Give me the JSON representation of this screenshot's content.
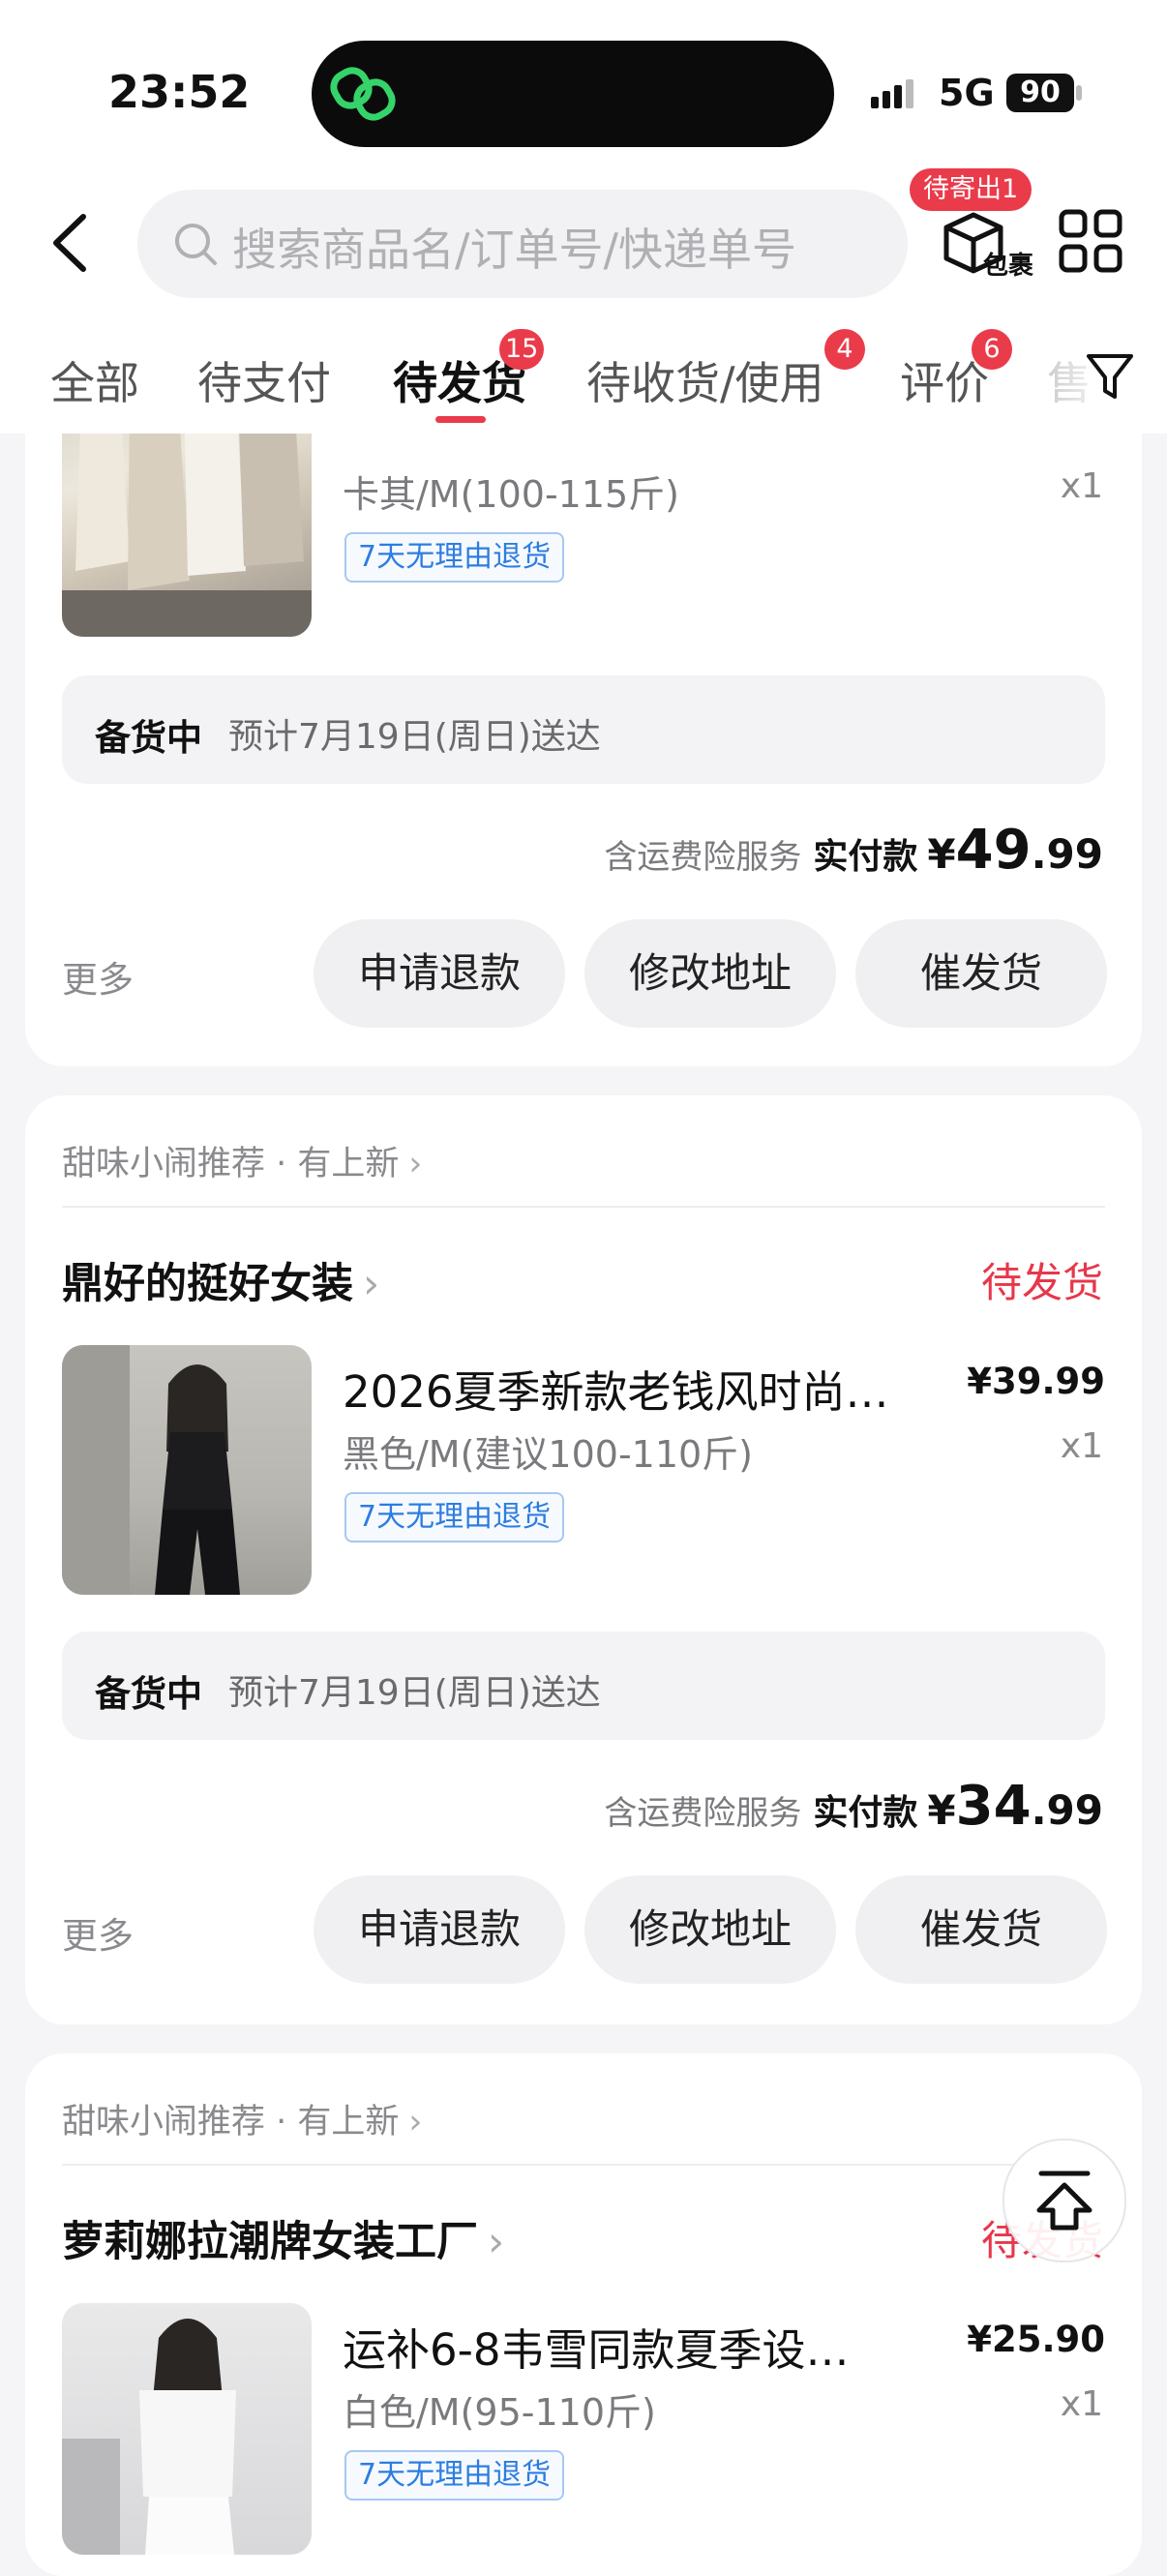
{
  "status_bar": {
    "time": "23:52",
    "network": "5G",
    "battery": "90"
  },
  "header": {
    "search_placeholder": "搜索商品名/订单号/快递单号",
    "package_label": "包裹",
    "package_badge": "待寄出1"
  },
  "tabs": [
    {
      "label": "全部",
      "badge": ""
    },
    {
      "label": "待支付",
      "badge": ""
    },
    {
      "label": "待发货",
      "badge": "15"
    },
    {
      "label": "待收货/使用",
      "badge": "4"
    },
    {
      "label": "评价",
      "badge": "6"
    },
    {
      "label": "售",
      "badge": ""
    }
  ],
  "orders": [
    {
      "spec": "卡其/M(100-115斤)",
      "qty": "x1",
      "tag": "7天无理由退货",
      "status_label": "备货中",
      "status_text": "预计7月19日(周日)送达",
      "insurance": "含运费险服务",
      "paid_label": "实付款",
      "paid_currency": "¥",
      "paid_int": "49",
      "paid_dec": ".99",
      "more": "更多",
      "buttons": [
        "申请退款",
        "修改地址",
        "催发货"
      ]
    },
    {
      "recommend": "甜味小闹推荐 · 有上新",
      "shop": "鼎好的挺好女装",
      "shop_state": "待发货",
      "title": "2026夏季新款老钱风时尚…",
      "price": "¥39.99",
      "spec": "黑色/M(建议100-110斤)",
      "qty": "x1",
      "tag": "7天无理由退货",
      "status_label": "备货中",
      "status_text": "预计7月19日(周日)送达",
      "insurance": "含运费险服务",
      "paid_label": "实付款",
      "paid_currency": "¥",
      "paid_int": "34",
      "paid_dec": ".99",
      "more": "更多",
      "buttons": [
        "申请退款",
        "修改地址",
        "催发货"
      ]
    },
    {
      "recommend": "甜味小闹推荐 · 有上新",
      "shop": "萝莉娜拉潮牌女装工厂",
      "shop_state": "待发货",
      "title": "运补6-8韦雪同款夏季设…",
      "price": "¥25.90",
      "spec": "白色/M(95-110斤)",
      "qty": "x1",
      "tag": "7天无理由退货"
    }
  ],
  "colors": {
    "accent": "#ea3b4b",
    "tag_blue": "#2d7de0"
  },
  "icons": [
    "back-icon",
    "search-icon",
    "package-icon",
    "grid-icon",
    "filter-icon",
    "scroll-top-icon"
  ]
}
